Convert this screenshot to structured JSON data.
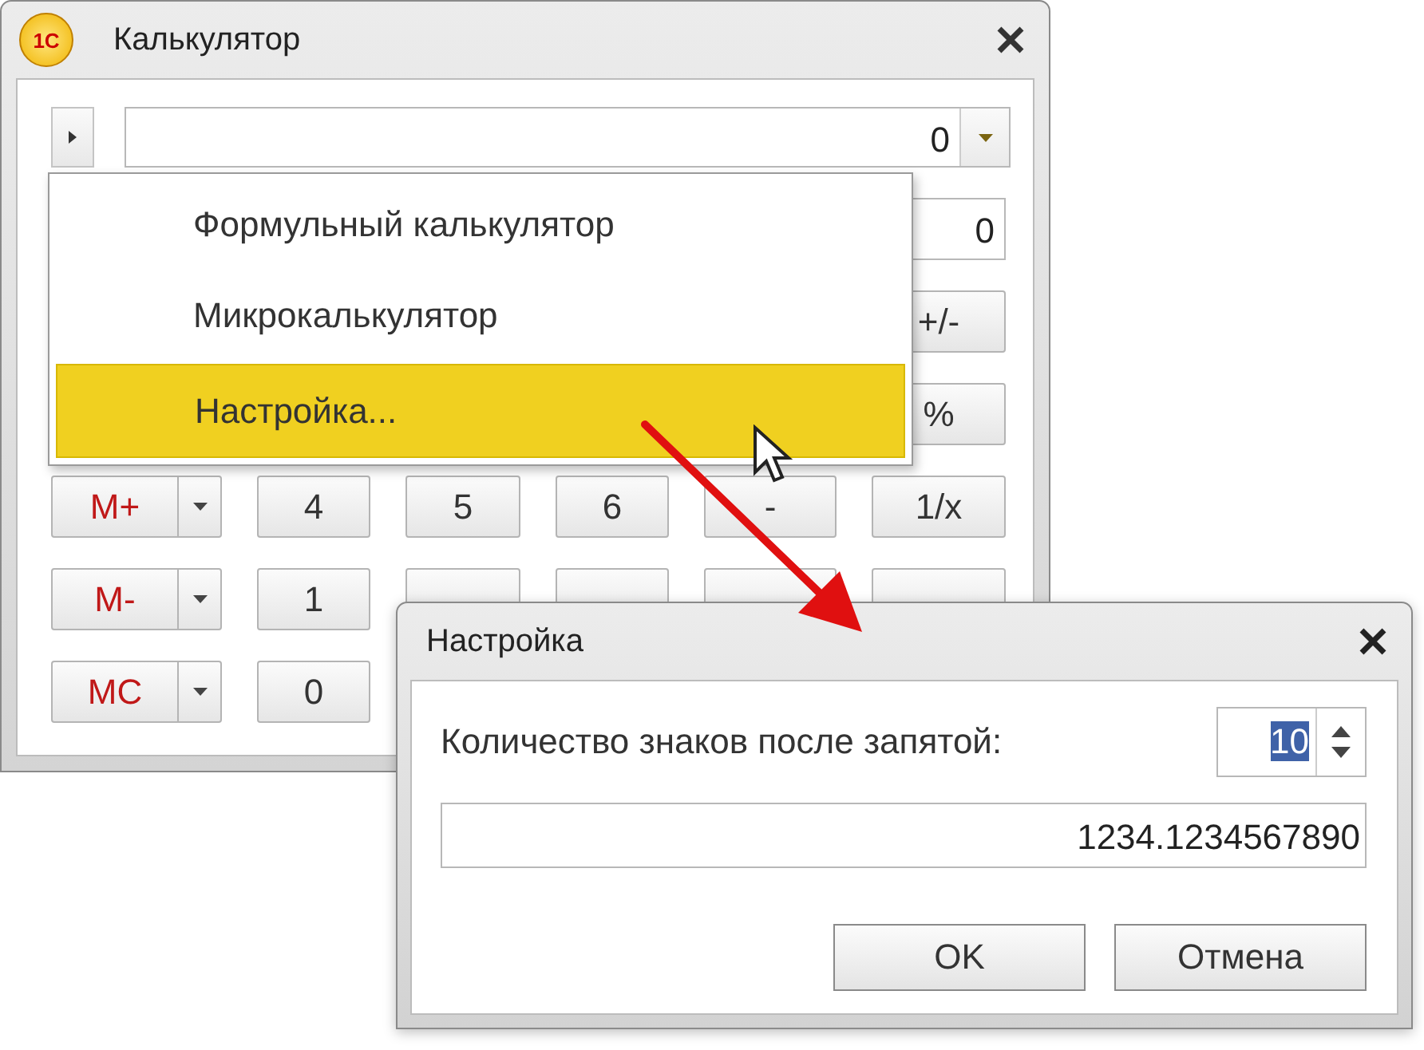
{
  "calculator": {
    "logo": "1С",
    "title": "Калькулятор",
    "display": {
      "value": "0"
    },
    "side_controls": [
      {
        "kind": "field",
        "value": "0"
      },
      {
        "kind": "key",
        "label": "+/-"
      },
      {
        "kind": "key",
        "label": "%"
      }
    ],
    "keypad_rows": [
      {
        "memory": "M+",
        "keys": [
          {
            "kind": "key",
            "label": "4"
          },
          {
            "kind": "key",
            "label": "5"
          },
          {
            "kind": "key",
            "label": "6"
          },
          {
            "kind": "key",
            "label": "-"
          },
          {
            "kind": "key",
            "label": "1/x"
          }
        ]
      },
      {
        "memory": "M-",
        "keys": [
          {
            "kind": "key",
            "label": "1"
          },
          {
            "kind": "blank"
          },
          {
            "kind": "blank"
          },
          {
            "kind": "blank"
          },
          {
            "kind": "blank"
          }
        ]
      },
      {
        "memory": "MC",
        "keys": [
          {
            "kind": "key",
            "label": "0"
          }
        ]
      }
    ],
    "menu": {
      "items": [
        {
          "label": "Формульный калькулятор",
          "selected": false
        },
        {
          "label": "Микрокалькулятор",
          "selected": false
        },
        {
          "label": "Настройка...",
          "selected": true
        }
      ]
    }
  },
  "dialog": {
    "title": "Настройка",
    "digits_label": "Количество знаков после запятой:",
    "digits": {
      "value": "10",
      "text_selected": true
    },
    "preview": "1234.1234567890",
    "buttons": [
      "OK",
      "Отмена"
    ]
  }
}
